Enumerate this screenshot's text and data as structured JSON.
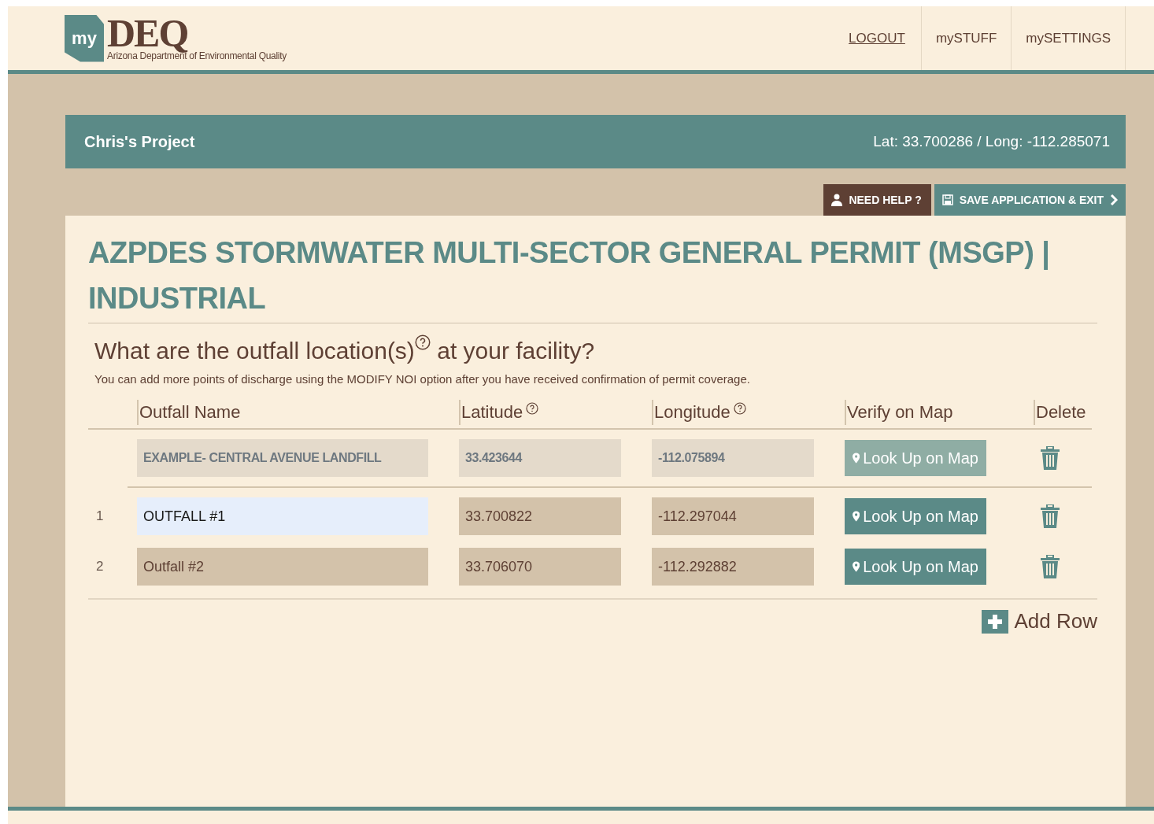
{
  "header": {
    "logo_badge": "my",
    "logo_title": "DEQ",
    "logo_subtitle": "Arizona Department of Environmental Quality",
    "nav": [
      {
        "label": "LOGOUT",
        "underlined": true
      },
      {
        "label": "mySTUFF",
        "underlined": false
      },
      {
        "label": "mySETTINGS",
        "underlined": false
      }
    ]
  },
  "project_bar": {
    "title": "Chris's Project",
    "coordinates": "Lat: 33.700286 / Long: -112.285071"
  },
  "actions": [
    {
      "kind": "help",
      "label": "NEED HELP ?"
    },
    {
      "kind": "save",
      "label": "SAVE APPLICATION & EXIT"
    }
  ],
  "form": {
    "title": "AZPDES STORMWATER MULTI-SECTOR GENERAL PERMIT (MSGP) | INDUSTRIAL",
    "question": "What are the outfall location(s)",
    "question_end": " at your facility?",
    "note": "You can add more points of discharge using the MODIFY NOI option after you have received confirmation of permit coverage.",
    "columns": [
      {
        "label": "Outfall Name",
        "help": false
      },
      {
        "label": "Latitude",
        "help": true
      },
      {
        "label": "Longitude",
        "help": true
      },
      {
        "label": "Verify on Map",
        "help": false
      },
      {
        "label": "Delete",
        "help": false
      }
    ],
    "rows": [
      {
        "kind": "example",
        "number": "",
        "name": "EXAMPLE- CENTRAL AVENUE LANDFILL",
        "latitude": "33.423644",
        "longitude": "-112.075894",
        "map_button": "Look Up on Map",
        "focused": false,
        "disabled": true
      },
      {
        "kind": "entry",
        "number": "1",
        "name": "OUTFALL #1",
        "latitude": "33.700822",
        "longitude": "-112.297044",
        "map_button": "Look Up on Map",
        "focused": true,
        "disabled": false
      },
      {
        "kind": "entry",
        "number": "2",
        "name": "Outfall #2",
        "latitude": "33.706070",
        "longitude": "-112.292882",
        "map_button": "Look Up on Map",
        "focused": false,
        "disabled": false
      }
    ],
    "add_row": "Add Row"
  }
}
